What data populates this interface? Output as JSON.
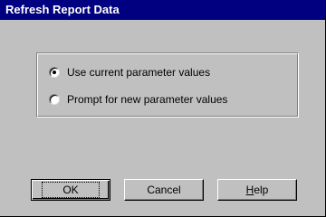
{
  "dialog": {
    "title": "Refresh Report Data"
  },
  "options": [
    {
      "label": "Use current parameter values",
      "selected": true
    },
    {
      "label": "Prompt for new parameter values",
      "selected": false
    }
  ],
  "buttons": {
    "ok": "OK",
    "cancel": "Cancel",
    "help_mnemonic": "H",
    "help_rest": "elp"
  }
}
